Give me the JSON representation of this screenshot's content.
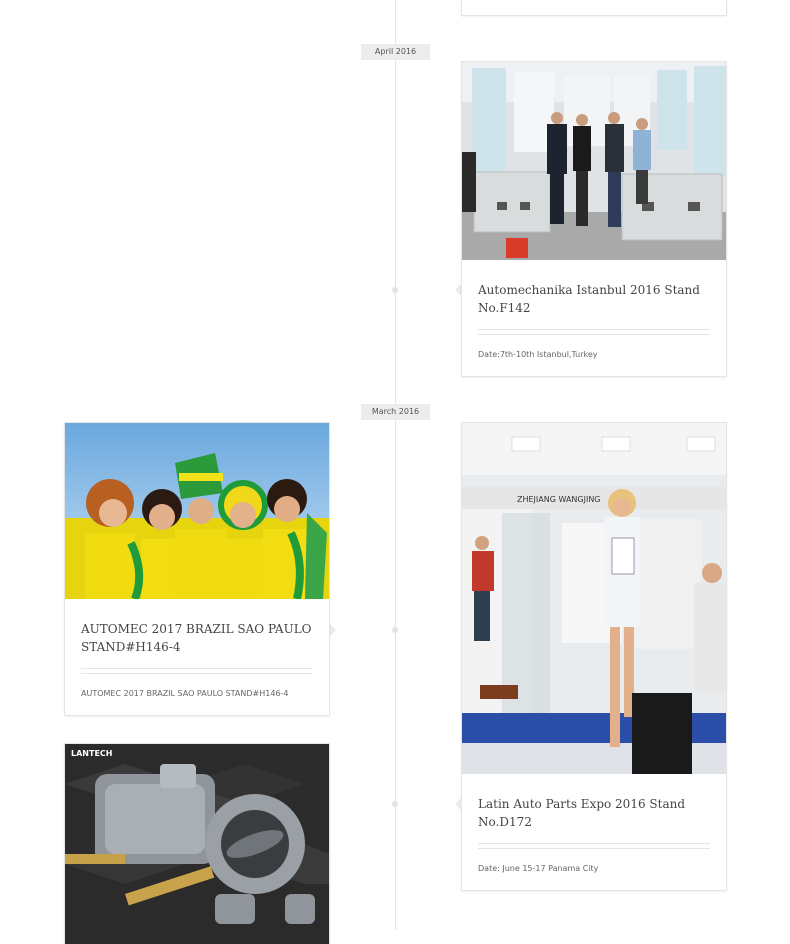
{
  "timeline": {
    "months": [
      "April 2016",
      "March 2016"
    ],
    "events": [
      {
        "title": "Automechanika Istanbul 2016 Stand No.F142",
        "meta": "Date:7th-10th Istanbul,Turkey",
        "image": "trade-show-booth-photo"
      },
      {
        "title": "AUTOMEC 2017 BRAZIL SAO PAULO STAND#H146-4",
        "meta": "AUTOMEC 2017 BRAZIL SAO PAULO STAND#H146-4",
        "image": "brazil-fans-photo"
      },
      {
        "title": "Latin Auto Parts Expo 2016 Stand No.D172",
        "meta": "Date: June 15-17 Panama City",
        "image": "expo-booth-model-photo",
        "sign": "ZHEJIANG WANGJING"
      },
      {
        "image": "throttle-body-product-photo",
        "watermark": "LANTECH"
      }
    ]
  },
  "colors": {
    "line": "#e3e3e3",
    "badge_bg": "#ececec",
    "card_border": "#e5e5e5",
    "title_text": "#444444",
    "meta_text": "#666666"
  }
}
